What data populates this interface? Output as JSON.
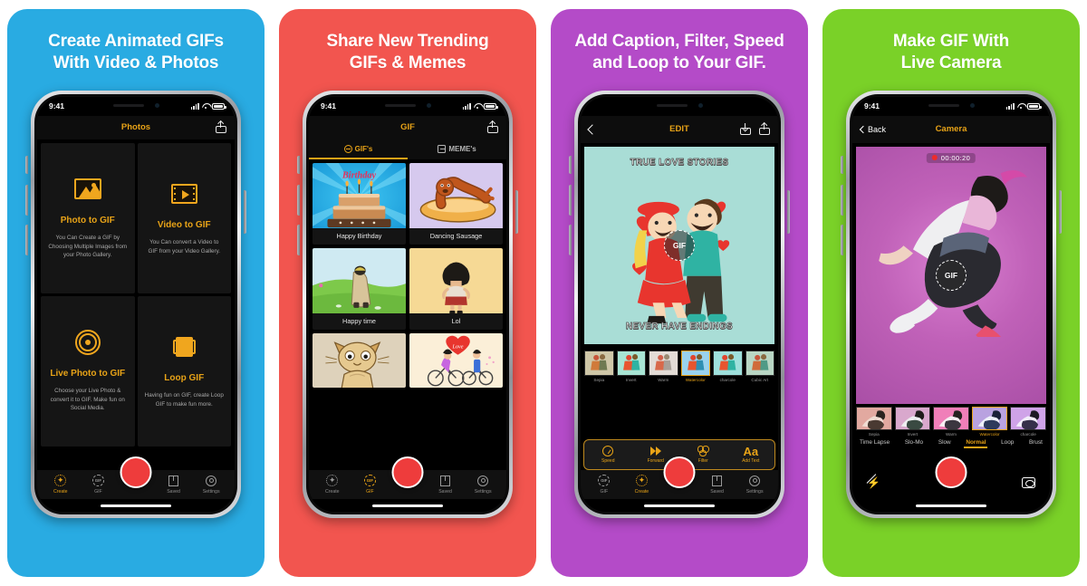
{
  "panels": [
    {
      "bg": "#29ABE2",
      "headline_l1": "Create Animated GIFs",
      "headline_l2": "With Video & Photos",
      "status_time": "9:41",
      "nav_title": "Photos",
      "features": [
        {
          "icon": "photo-icon",
          "title": "Photo to GIF",
          "desc": "You Can Create a GIF by Choosing Multiple Images from your Photo Gallery."
        },
        {
          "icon": "video-icon",
          "title": "Video to GIF",
          "desc": "You Can convert a Video to GIF from your Video Gallery."
        },
        {
          "icon": "live-photo-icon",
          "title": "Live Photo to GIF",
          "desc": "Choose your Live Photo & convert it to GIF. Make fun on Social Media."
        },
        {
          "icon": "loop-icon",
          "title": "Loop GIF",
          "desc": "Having fun on GIF, create Loop GIF to make fun more."
        }
      ],
      "tabs": [
        {
          "label": "Create",
          "icon": "create-star-icon",
          "active": true
        },
        {
          "label": "GIF",
          "icon": "gif-circle-icon",
          "active": false
        },
        {
          "label": "Saved",
          "icon": "saved-icon",
          "active": false
        },
        {
          "label": "Settings",
          "icon": "gear-icon",
          "active": false
        }
      ]
    },
    {
      "bg": "#F2554F",
      "headline_l1": "Share New Trending",
      "headline_l2": "GIFs & Memes",
      "status_time": "9:41",
      "nav_title": "GIF",
      "segments": [
        {
          "label": "GIF's",
          "active": true
        },
        {
          "label": "MEME's",
          "active": false
        }
      ],
      "gifs": [
        {
          "caption": "Happy Birthday",
          "art": "birthday-cake"
        },
        {
          "caption": "Dancing Sausage",
          "art": "dancing-sausage"
        },
        {
          "caption": "Happy time",
          "art": "happy-time"
        },
        {
          "caption": "Lol",
          "art": "lol-girl"
        },
        {
          "caption": "",
          "art": "cat"
        },
        {
          "caption": "",
          "art": "love-bikes"
        }
      ],
      "tabs": [
        {
          "label": "Create",
          "icon": "create-star-icon",
          "active": false
        },
        {
          "label": "GIF",
          "icon": "gif-circle-icon",
          "active": true
        },
        {
          "label": "Saved",
          "icon": "saved-icon",
          "active": false
        },
        {
          "label": "Settings",
          "icon": "gear-icon",
          "active": false
        }
      ]
    },
    {
      "bg": "#B44BC8",
      "headline_l1": "Add Caption, Filter, Speed",
      "headline_l2": "and Loop to Your GIF.",
      "nav_title": "EDIT",
      "caption_top": "TRUE LOVE STORIES",
      "caption_bottom": "NEVER HAVE ENDINGS",
      "gif_badge": "GIF",
      "filters": [
        {
          "label": "Sepia",
          "selected": false,
          "tint": "#cfc7a8"
        },
        {
          "label": "Invert",
          "selected": false,
          "tint": "#a8e5d4"
        },
        {
          "label": "Warm",
          "selected": false,
          "tint": "#e3dcd6"
        },
        {
          "label": "Watercolor",
          "selected": true,
          "tint": "#9ad2ee"
        },
        {
          "label": "charcole",
          "selected": false,
          "tint": "#9fe0dc"
        },
        {
          "label": "Cubic Art",
          "selected": false,
          "tint": "#b9d6c4"
        }
      ],
      "edit_tools": [
        {
          "label": "Speed",
          "icon": "speedometer-icon"
        },
        {
          "label": "Forward",
          "icon": "fast-forward-icon"
        },
        {
          "label": "Filter",
          "icon": "filter-rings-icon"
        },
        {
          "label": "Add Text",
          "icon": "text-aa-icon"
        }
      ],
      "tabs": [
        {
          "label": "GIF",
          "icon": "gif-circle-icon",
          "active": false
        },
        {
          "label": "Create",
          "icon": "create-star-icon",
          "active": true
        },
        {
          "label": "Saved",
          "icon": "saved-icon",
          "active": false
        },
        {
          "label": "Settings",
          "icon": "gear-icon",
          "active": false
        }
      ]
    },
    {
      "bg": "#7AD128",
      "headline_l1": "Make GIF With",
      "headline_l2": "Live Camera",
      "status_time": "9:41",
      "back_label": "Back",
      "nav_title": "Camera",
      "rec_timer": "00:00:20",
      "gif_badge": "GIF",
      "filters": [
        {
          "label": "Sepia",
          "selected": false,
          "tint": "#e2a9a0"
        },
        {
          "label": "Invert",
          "selected": false,
          "tint": "#d9a8cd"
        },
        {
          "label": "Warm",
          "selected": false,
          "tint": "#f07fb9"
        },
        {
          "label": "Watercolor",
          "selected": true,
          "tint": "#b9a2e0"
        },
        {
          "label": "charcole",
          "selected": false,
          "tint": "#cfa3e8"
        }
      ],
      "modes": [
        {
          "label": "Time Lapse",
          "active": false
        },
        {
          "label": "Slo-Mo",
          "active": false
        },
        {
          "label": "Slow",
          "active": false
        },
        {
          "label": "Normal",
          "active": true
        },
        {
          "label": "Loop",
          "active": false
        },
        {
          "label": "Brust",
          "active": false
        }
      ],
      "flash_icon": "flash-off-icon",
      "flip_icon": "flip-camera-icon"
    }
  ],
  "colors": {
    "accent_orange": "#E8A317",
    "record_red": "#EE3C3C",
    "panel_blue": "#29ABE2",
    "panel_red": "#F2554F",
    "panel_purple": "#B44BC8",
    "panel_green": "#7AD128"
  }
}
